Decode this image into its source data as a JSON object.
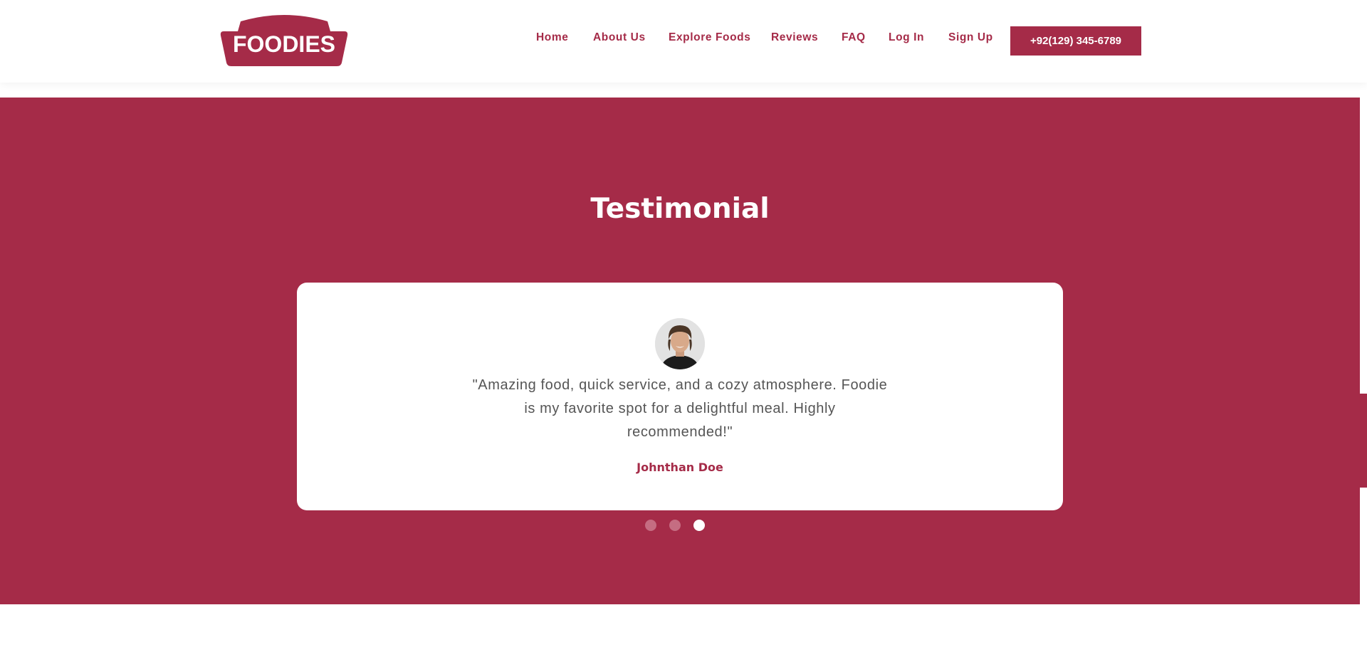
{
  "brand": {
    "logo_text": "FOODIES",
    "color": "#a52b48"
  },
  "nav": {
    "items": [
      {
        "label": "Home"
      },
      {
        "label": "About Us"
      },
      {
        "label": "Explore Foods"
      },
      {
        "label": "Reviews"
      },
      {
        "label": "FAQ"
      },
      {
        "label": "Log In"
      },
      {
        "label": "Sign Up"
      }
    ],
    "phone_button": "+92(129) 345-6789"
  },
  "testimonial": {
    "title": "Testimonial",
    "quote": "\"Amazing food, quick service, and a cozy atmosphere. Foodie is my favorite spot for a delightful meal. Highly recommended!\"",
    "author": "Johnthan Doe",
    "avatar_icon": "person-avatar",
    "carousel": {
      "total": 3,
      "active_index": 3
    }
  }
}
